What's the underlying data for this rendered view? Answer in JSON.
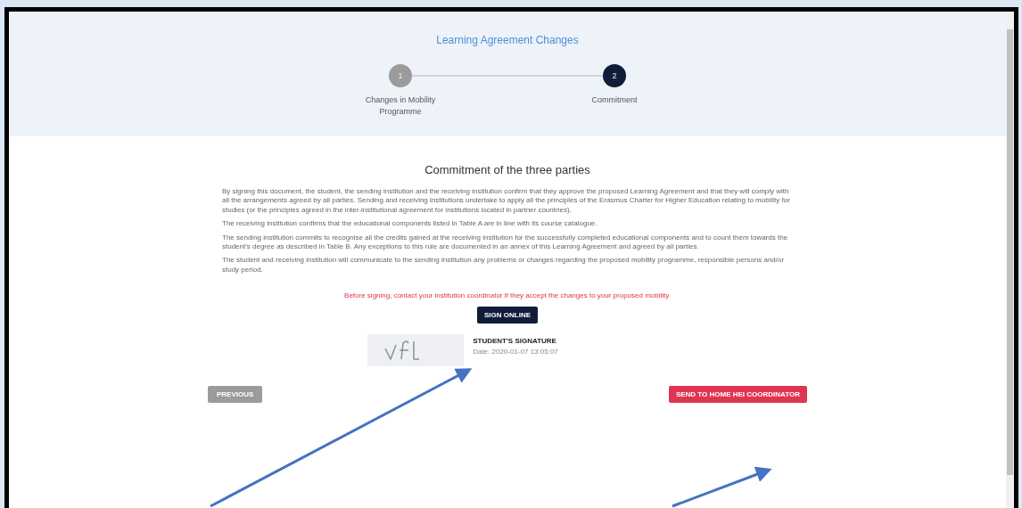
{
  "header": {
    "title": "Learning Agreement Changes"
  },
  "steps": [
    {
      "number": "1",
      "label": "Changes in Mobility Programme",
      "selected": false
    },
    {
      "number": "2",
      "label": "Commitment",
      "selected": true
    }
  ],
  "section": {
    "title": "Commitment of the three parties",
    "paragraphs": [
      "By signing this document, the student, the sending institution and the receiving institution confirm that they approve the proposed Learning Agreement and that they will comply with all the arrangements agreed by all parties. Sending and receiving institutions undertake to apply all the principles of the Erasmus Charter for Higher Education relating to mobility for studies (or the principles agreed in the inter-institutional agreement for institutions located in partner countries).",
      "The receiving institution confirms that the educational components listed in Table A are in line with its course catalogue.",
      "The sending institution commits to recognise all the credits gained at the receiving institution for the successfully completed educational components and to count them towards the student's degree as described in Table B. Any exceptions to this rule are documented in an annex of this Learning Agreement and agreed by all parties.",
      "The student and receiving institution will communicate to the sending institution any problems or changes regarding the proposed mobility programme, responsible persons and/or study period."
    ],
    "warning": "Before signing, contact your institution coordinator if they accept the changes to your proposed mobility.",
    "sign_button": "SIGN ONLINE",
    "signature": {
      "label": "STUDENT'S SIGNATURE",
      "date": "Date: 2020-01-07 13:05:07"
    }
  },
  "footer": {
    "previous": "PREVIOUS",
    "send": "SEND TO HOME HEI COORDINATOR"
  }
}
